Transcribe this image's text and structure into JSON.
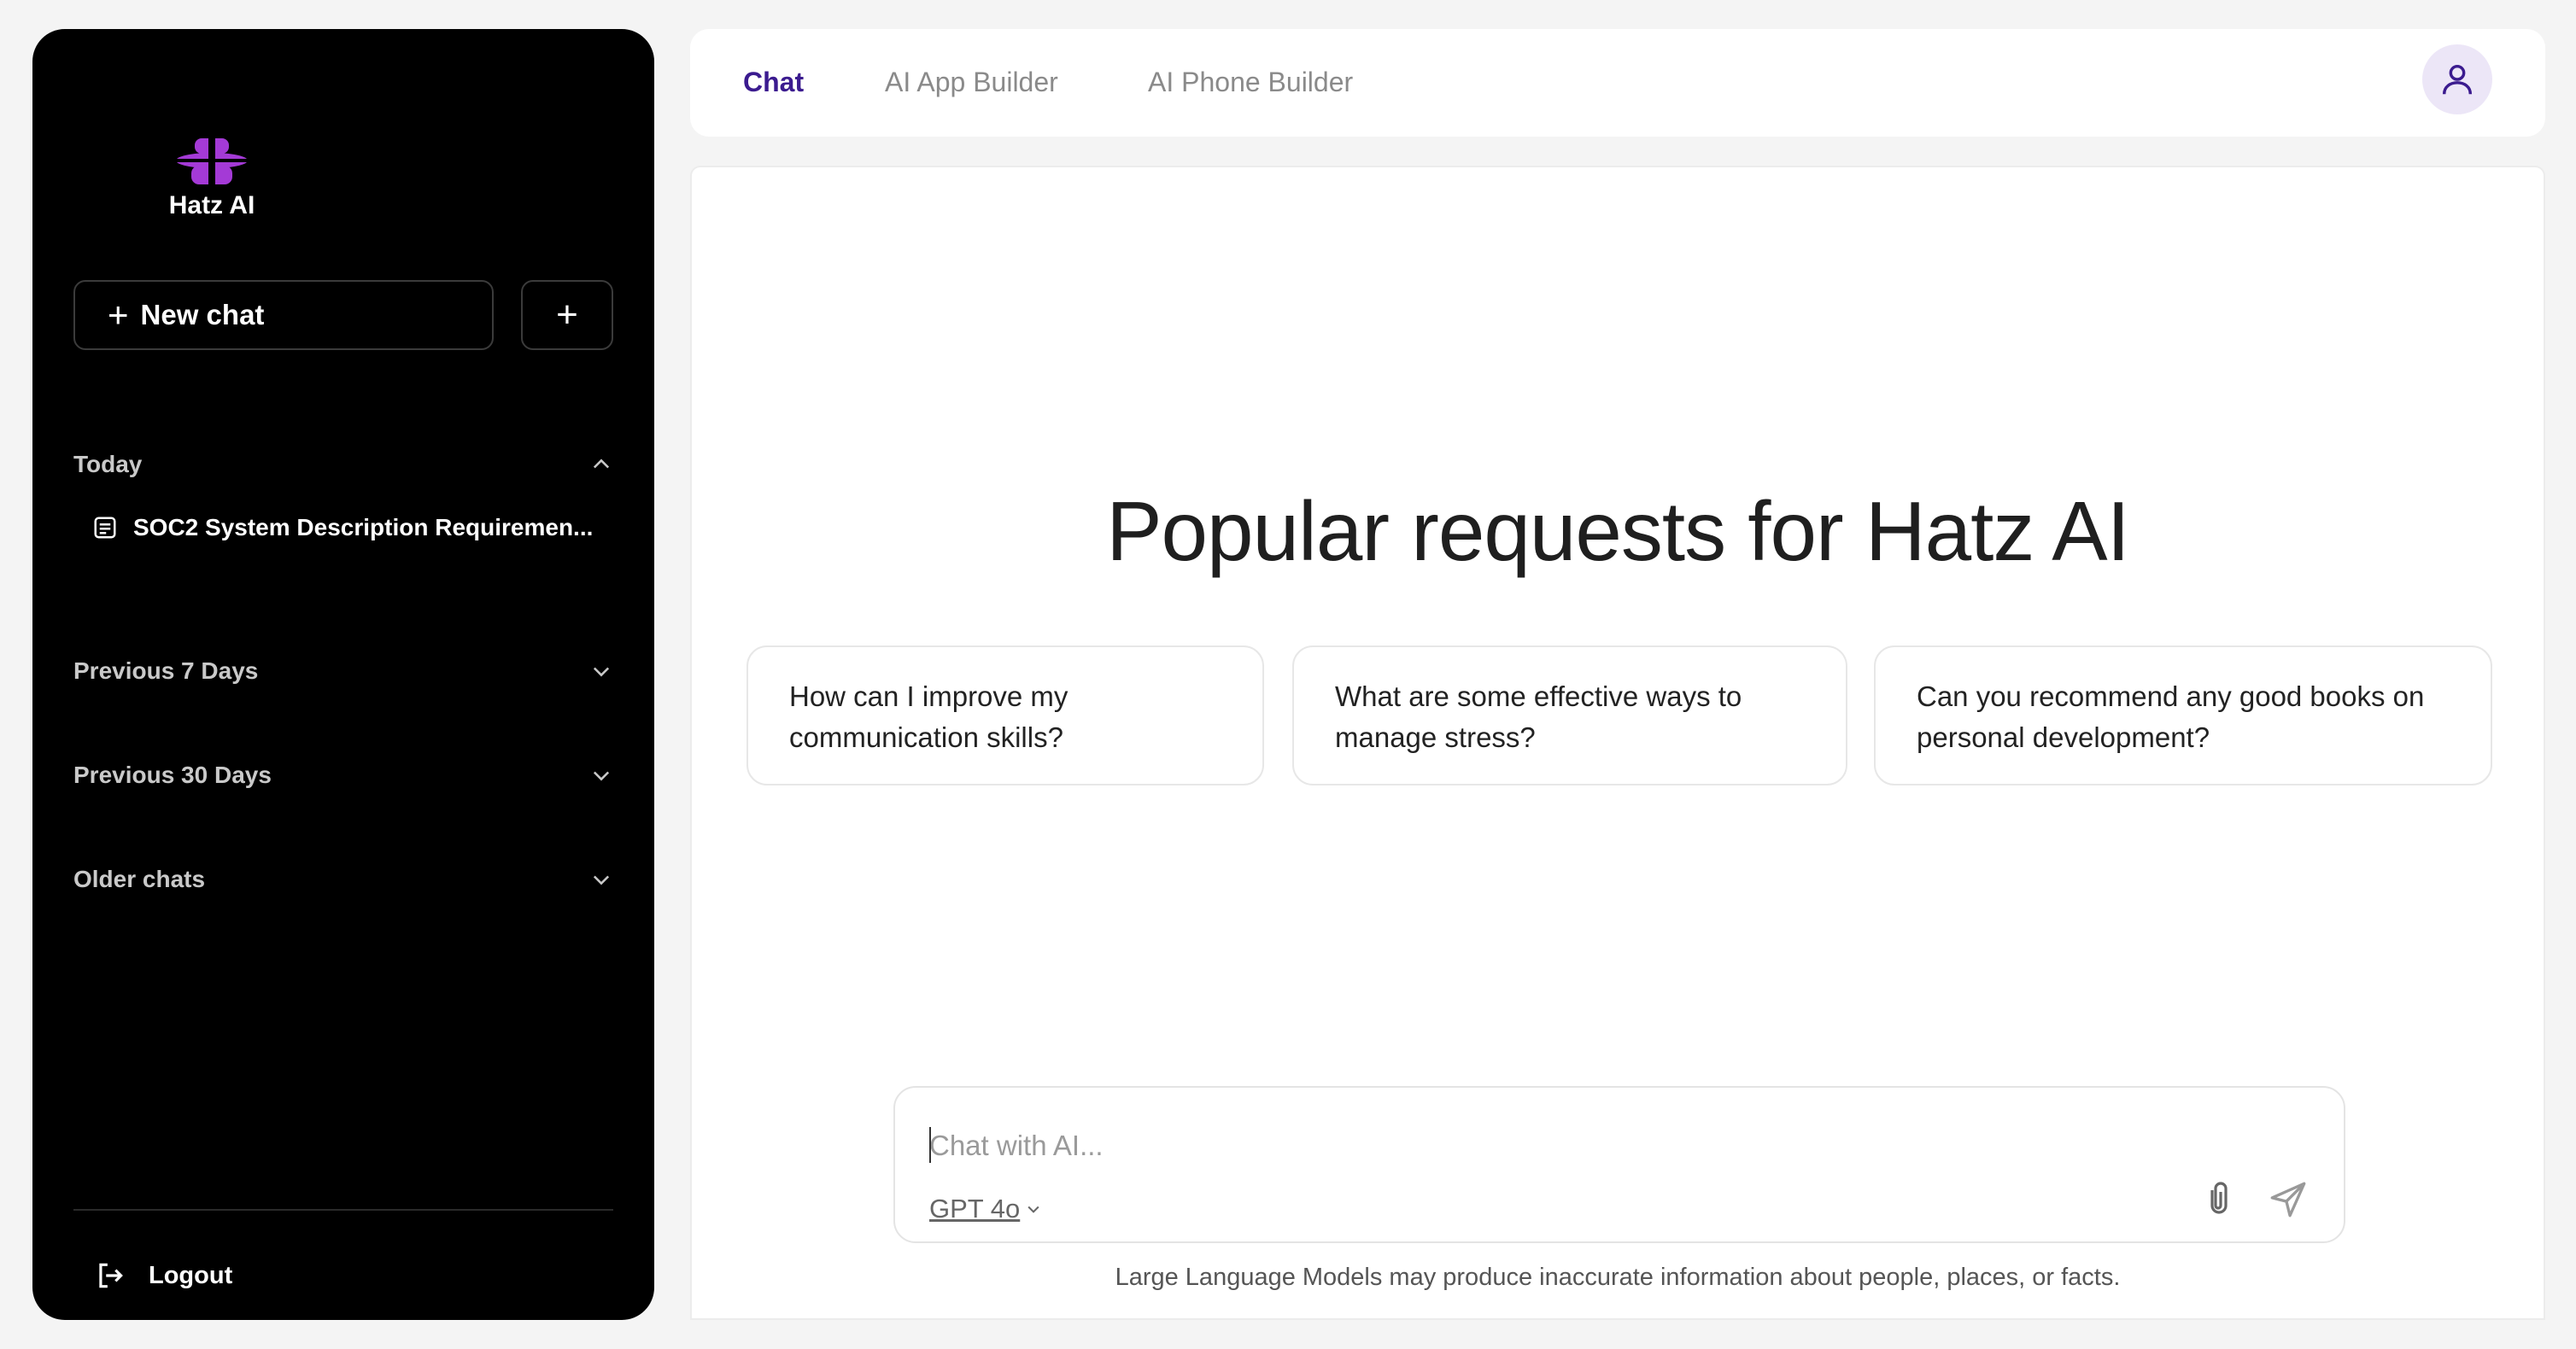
{
  "sidebar": {
    "logo_text": "Hatz AI",
    "new_chat_label": "New chat",
    "add_label": "+",
    "sections": [
      {
        "label": "Today",
        "expanded": true
      },
      {
        "label": "Previous 7 Days",
        "expanded": false
      },
      {
        "label": "Previous 30 Days",
        "expanded": false
      },
      {
        "label": "Older chats",
        "expanded": false
      }
    ],
    "today_chats": [
      "SOC2 System Description Requiremen..."
    ],
    "logout_label": "Logout"
  },
  "header": {
    "tabs": [
      {
        "label": "Chat",
        "active": true
      },
      {
        "label": "AI App Builder",
        "active": false
      },
      {
        "label": "AI Phone Builder",
        "active": false
      }
    ]
  },
  "main": {
    "headline": "Popular requests for Hatz AI",
    "suggestions": [
      "How can I improve my communication skills?",
      "What are some effective ways to manage stress?",
      "Can you recommend any good books on personal development?"
    ],
    "composer": {
      "placeholder": "Chat with AI...",
      "value": "",
      "model": "GPT 4o"
    },
    "disclaimer": "Large Language Models may produce inaccurate information about people, places, or facts."
  },
  "colors": {
    "brand_purple": "#a43ad6",
    "active_tab": "#3b1b8f",
    "sidebar_bg": "#000000"
  },
  "icons": [
    "hatz-logo-icon",
    "plus-icon",
    "chevron-up-icon",
    "chevron-down-icon",
    "document-icon",
    "logout-icon",
    "user-icon",
    "paperclip-icon",
    "send-icon"
  ]
}
